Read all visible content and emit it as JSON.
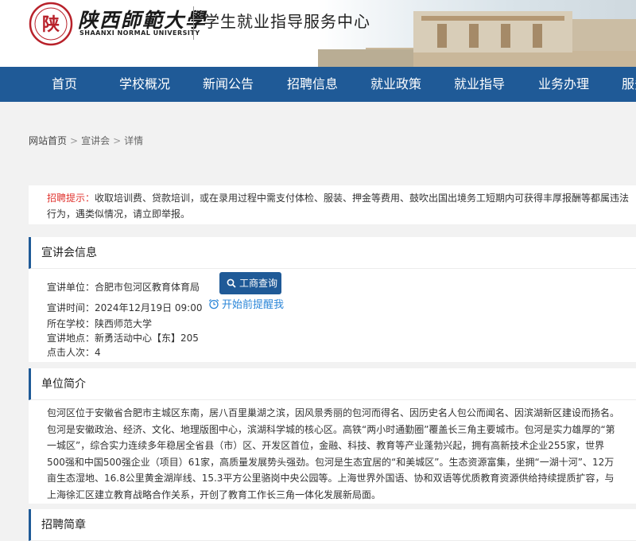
{
  "header": {
    "logo_mark": "陕",
    "school_name_cn": "陕西師範大學",
    "school_name_en": "SHAANXI NORMAL UNIVERSITY",
    "site_title": "学生就业指导服务中心"
  },
  "nav": {
    "items": [
      "首页",
      "学校概况",
      "新闻公告",
      "招聘信息",
      "就业政策",
      "就业指导",
      "业务办理",
      "服务"
    ]
  },
  "breadcrumb": {
    "home": "网站首页",
    "level1": "宣讲会",
    "level2": "详情",
    "separator": ">"
  },
  "notice": {
    "tip_label": "招聘提示：",
    "text": "收取培训费、贷款培训，或在录用过程中需支付体检、服装、押金等费用、鼓吹出国出境务工短期内可获得丰厚报酬等都属违法行为，遇类似情况，请立即举报。"
  },
  "talk_info": {
    "section_title": "宣讲会信息",
    "unit_label": "宣讲单位：",
    "unit_value": "合肥市包河区教育体育局",
    "search_button": "工商查询",
    "time_label": "宣讲时间：",
    "time_value": "2024年12月19日 09:00",
    "remind_label": "开始前提醒我",
    "school_label": "所在学校：",
    "school_value": "陕西师范大学",
    "location_label": "宣讲地点：",
    "location_value": "新勇活动中心【东】205",
    "clicks_label": "点击人次：",
    "clicks_value": "4"
  },
  "unit_intro": {
    "section_title": "单位简介",
    "text": "包河区位于安徽省合肥市主城区东南，居八百里巢湖之滨，因风景秀丽的包河而得名、因历史名人包公而闻名、因滨湖新区建设而扬名。包河是安徽政治、经济、文化、地理版图中心，滨湖科学城的核心区。高铁“两小时通勤圈”覆盖长三角主要城市。包河是实力雄厚的“第一城区”，综合实力连续多年稳居全省县（市）区、开发区首位，金融、科技、教育等产业蓬勃兴起，拥有高新技术企业255家，世界500强和中国500强企业（项目）61家，高质量发展势头强劲。包河是生态宜居的“和美城区”。生态资源富集，坐拥“一湖十河”、12万亩生态湿地、16.8公里黄金湖岸线、15.3平方公里骆岗中央公园等。上海世界外国语、协和双语等优质教育资源供给持续提质扩容，与上海徐汇区建立教育战略合作关系，开创了教育工作长三角一体化发展新局面。"
  },
  "recruit": {
    "section_title": "招聘简章"
  },
  "colors": {
    "nav_bg": "#1f5a97",
    "accent_red": "#e0342f",
    "link_blue": "#2b86d8",
    "logo_red": "#b8212a"
  },
  "icons": {
    "logo": "school-seal-icon",
    "search": "search-icon",
    "alarm": "alarm-clock-icon"
  }
}
